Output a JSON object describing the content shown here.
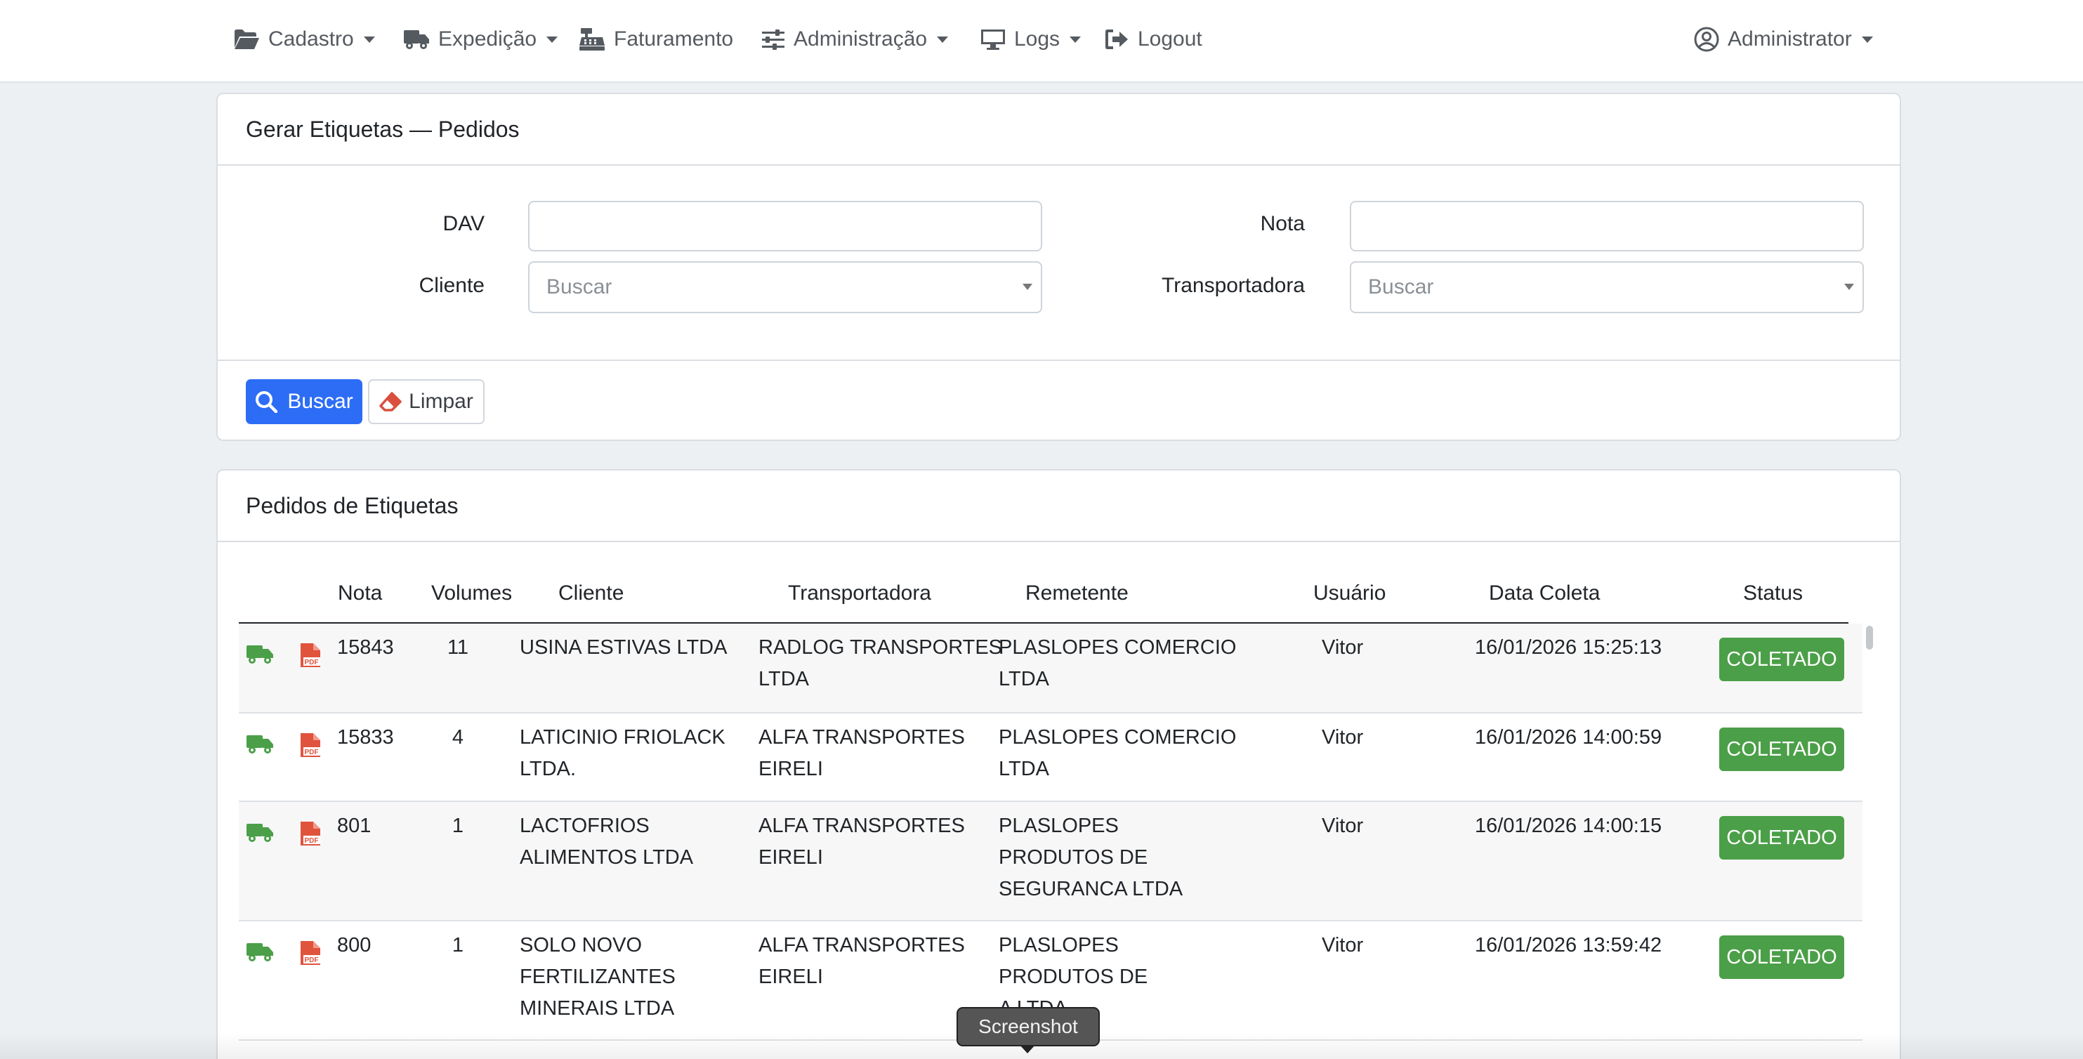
{
  "navbar": {
    "items": [
      {
        "label": "Cadastro",
        "icon": "folder-open-icon",
        "dropdown": true
      },
      {
        "label": "Expedição",
        "icon": "truck-icon",
        "dropdown": true
      },
      {
        "label": "Faturamento",
        "icon": "cash-register-icon",
        "dropdown": false
      },
      {
        "label": "Administração",
        "icon": "sliders-icon",
        "dropdown": true
      },
      {
        "label": "Logs",
        "icon": "monitor-icon",
        "dropdown": true
      },
      {
        "label": "Logout",
        "icon": "logout-icon",
        "dropdown": false
      }
    ],
    "user": {
      "label": "Administrator",
      "icon": "user-circle-icon"
    }
  },
  "search_card": {
    "title": "Gerar Etiquetas — Pedidos",
    "fields": {
      "dav": {
        "label": "DAV",
        "value": ""
      },
      "nota": {
        "label": "Nota",
        "value": ""
      },
      "cliente": {
        "label": "Cliente",
        "placeholder": "Buscar"
      },
      "transportadora": {
        "label": "Transportadora",
        "placeholder": "Buscar"
      }
    },
    "buttons": {
      "buscar": "Buscar",
      "limpar": "Limpar"
    }
  },
  "table_card": {
    "title": "Pedidos de Etiquetas",
    "columns": [
      "Nota",
      "Volumes",
      "Cliente",
      "Transportadora",
      "Remetente",
      "Usuário",
      "Data Coleta",
      "Status"
    ],
    "rows": [
      {
        "nota": "15843",
        "volumes": "11",
        "cliente": [
          "USINA ESTIVAS LTDA"
        ],
        "transportadora": [
          "RADLOG TRANSPORTES",
          "LTDA"
        ],
        "remetente": [
          "PLASLOPES COMERCIO",
          "LTDA"
        ],
        "usuario": "Vitor",
        "data_coleta": "16/01/2026 15:25:13",
        "status": "COLETADO"
      },
      {
        "nota": "15833",
        "volumes": "4",
        "cliente": [
          "LATICINIO FRIOLACK",
          "LTDA."
        ],
        "transportadora": [
          "ALFA TRANSPORTES",
          "EIRELI"
        ],
        "remetente": [
          "PLASLOPES COMERCIO",
          "LTDA"
        ],
        "usuario": "Vitor",
        "data_coleta": "16/01/2026 14:00:59",
        "status": "COLETADO"
      },
      {
        "nota": "801",
        "volumes": "1",
        "cliente": [
          "LACTOFRIOS",
          "ALIMENTOS LTDA"
        ],
        "transportadora": [
          "ALFA TRANSPORTES",
          "EIRELI"
        ],
        "remetente": [
          "PLASLOPES",
          "PRODUTOS DE",
          "SEGURANCA LTDA"
        ],
        "usuario": "Vitor",
        "data_coleta": "16/01/2026 14:00:15",
        "status": "COLETADO"
      },
      {
        "nota": "800",
        "volumes": "1",
        "cliente": [
          "SOLO NOVO",
          "FERTILIZANTES",
          "MINERAIS LTDA"
        ],
        "transportadora": [
          "ALFA TRANSPORTES",
          "EIRELI"
        ],
        "remetente": [
          "PLASLOPES",
          "PRODUTOS DE",
          "A LTDA"
        ],
        "usuario": "Vitor",
        "data_coleta": "16/01/2026 13:59:42",
        "status": "COLETADO"
      }
    ]
  },
  "tooltip": {
    "label": "Screenshot"
  },
  "colors": {
    "primary": "#2d6df6",
    "success": "#4b9f48",
    "pdf": "#e0533d",
    "truck": "#4b9f48"
  }
}
